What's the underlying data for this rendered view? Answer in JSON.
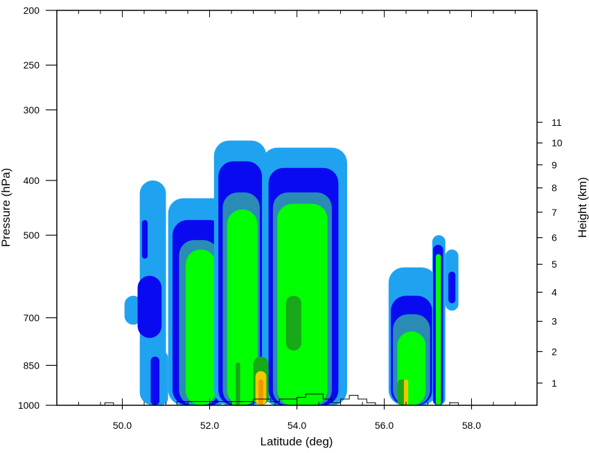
{
  "chart_data": {
    "type": "heatmap",
    "title": "",
    "xlabel": "Latitude (deg)",
    "ylabel_left": "Pressure (hPa)",
    "ylabel_right": "Height (km)",
    "xlim": [
      48.5,
      59.5
    ],
    "ylim_pressure": [
      1000,
      200
    ],
    "y_scale": "log",
    "x_ticks": [
      {
        "value": 50,
        "label": "50.0"
      },
      {
        "value": 52,
        "label": "52.0"
      },
      {
        "value": 54,
        "label": "54.0"
      },
      {
        "value": 56,
        "label": "56.0"
      },
      {
        "value": 58,
        "label": "58.0"
      }
    ],
    "x_minor_step": 0.5,
    "y_ticks_pressure": [
      {
        "value": 1000,
        "label": "1000"
      },
      {
        "value": 850,
        "label": "850"
      },
      {
        "value": 700,
        "label": "700"
      },
      {
        "value": 500,
        "label": "500"
      },
      {
        "value": 400,
        "label": "400"
      },
      {
        "value": 300,
        "label": "300"
      },
      {
        "value": 250,
        "label": "250"
      },
      {
        "value": 200,
        "label": "200"
      }
    ],
    "y_ticks_height": [
      {
        "value": 1,
        "label": "1"
      },
      {
        "value": 2,
        "label": "2"
      },
      {
        "value": 3,
        "label": "3"
      },
      {
        "value": 4,
        "label": "4"
      },
      {
        "value": 5,
        "label": "5"
      },
      {
        "value": 6,
        "label": "6"
      },
      {
        "value": 7,
        "label": "7"
      },
      {
        "value": 8,
        "label": "8"
      },
      {
        "value": 9,
        "label": "9"
      },
      {
        "value": 10,
        "label": "10"
      },
      {
        "value": 11,
        "label": "11"
      }
    ],
    "grid": false,
    "legend": "none",
    "levels": [
      {
        "color": "#1fa3f0"
      },
      {
        "color": "#0a0af0"
      },
      {
        "color": "#2a8cb4"
      },
      {
        "color": "#00ff00"
      },
      {
        "color": "#18a818"
      },
      {
        "color": "#f0c800"
      },
      {
        "color": "#f09600"
      }
    ],
    "cells": [
      {
        "level": 0,
        "x": [
          50.4,
          51.0
        ],
        "p": [
          1000,
          400
        ]
      },
      {
        "level": 1,
        "x": [
          50.45,
          50.58
        ],
        "p": [
          550,
          470
        ]
      },
      {
        "level": 0,
        "x": [
          50.05,
          50.45
        ],
        "p": [
          720,
          640
        ]
      },
      {
        "level": 1,
        "x": [
          50.35,
          50.9
        ],
        "p": [
          760,
          590
        ]
      },
      {
        "level": 0,
        "x": [
          50.7,
          51.05
        ],
        "p": [
          1000,
          800
        ]
      },
      {
        "level": 1,
        "x": [
          50.65,
          50.85
        ],
        "p": [
          1000,
          820
        ]
      },
      {
        "level": 0,
        "x": [
          51.05,
          52.5
        ],
        "p": [
          1000,
          430
        ]
      },
      {
        "level": 1,
        "x": [
          51.15,
          52.35
        ],
        "p": [
          1000,
          470
        ]
      },
      {
        "level": 2,
        "x": [
          51.3,
          52.2
        ],
        "p": [
          1000,
          510
        ]
      },
      {
        "level": 3,
        "x": [
          51.45,
          52.15
        ],
        "p": [
          1000,
          530
        ]
      },
      {
        "level": 0,
        "x": [
          52.1,
          53.3
        ],
        "p": [
          1000,
          340
        ]
      },
      {
        "level": 1,
        "x": [
          52.2,
          53.2
        ],
        "p": [
          1000,
          370
        ]
      },
      {
        "level": 2,
        "x": [
          52.3,
          53.15
        ],
        "p": [
          1000,
          420
        ]
      },
      {
        "level": 3,
        "x": [
          52.4,
          53.1
        ],
        "p": [
          1000,
          450
        ]
      },
      {
        "level": 0,
        "x": [
          53.2,
          55.15
        ],
        "p": [
          1000,
          350
        ]
      },
      {
        "level": 1,
        "x": [
          53.35,
          54.95
        ],
        "p": [
          1000,
          380
        ]
      },
      {
        "level": 2,
        "x": [
          53.45,
          54.8
        ],
        "p": [
          1000,
          420
        ]
      },
      {
        "level": 3,
        "x": [
          53.55,
          54.7
        ],
        "p": [
          1000,
          440
        ]
      },
      {
        "level": 4,
        "x": [
          53.75,
          54.1
        ],
        "p": [
          800,
          640
        ]
      },
      {
        "level": 3,
        "x": [
          52.5,
          52.6
        ],
        "p": [
          1000,
          720
        ]
      },
      {
        "level": 4,
        "x": [
          52.6,
          52.7
        ],
        "p": [
          1000,
          840
        ]
      },
      {
        "level": 4,
        "x": [
          53.0,
          53.35
        ],
        "p": [
          1000,
          820
        ]
      },
      {
        "level": 5,
        "x": [
          53.05,
          53.3
        ],
        "p": [
          1000,
          870
        ]
      },
      {
        "level": 6,
        "x": [
          53.12,
          53.23
        ],
        "p": [
          1000,
          900
        ]
      },
      {
        "level": 0,
        "x": [
          56.1,
          57.2
        ],
        "p": [
          1000,
          570
        ]
      },
      {
        "level": 1,
        "x": [
          56.15,
          57.1
        ],
        "p": [
          1000,
          640
        ]
      },
      {
        "level": 2,
        "x": [
          56.2,
          57.05
        ],
        "p": [
          1000,
          690
        ]
      },
      {
        "level": 3,
        "x": [
          56.3,
          56.95
        ],
        "p": [
          1000,
          740
        ]
      },
      {
        "level": 4,
        "x": [
          56.3,
          56.5
        ],
        "p": [
          1000,
          900
        ]
      },
      {
        "level": 5,
        "x": [
          56.45,
          56.55
        ],
        "p": [
          1000,
          900
        ]
      },
      {
        "level": 0,
        "x": [
          57.1,
          57.4
        ],
        "p": [
          1000,
          500
        ]
      },
      {
        "level": 1,
        "x": [
          57.12,
          57.35
        ],
        "p": [
          1000,
          520
        ]
      },
      {
        "level": 3,
        "x": [
          57.18,
          57.3
        ],
        "p": [
          1000,
          540
        ]
      },
      {
        "level": 0,
        "x": [
          57.4,
          57.7
        ],
        "p": [
          680,
          530
        ]
      },
      {
        "level": 1,
        "x": [
          57.47,
          57.63
        ],
        "p": [
          660,
          580
        ]
      }
    ],
    "terrain_profile": [
      [
        49.5,
        1000
      ],
      [
        49.6,
        1000
      ],
      [
        49.6,
        990
      ],
      [
        49.8,
        990
      ],
      [
        49.8,
        1000
      ],
      [
        50.3,
        1000
      ],
      [
        51.25,
        1000
      ],
      [
        51.25,
        985
      ],
      [
        53.0,
        985
      ],
      [
        53.0,
        975
      ],
      [
        53.4,
        975
      ],
      [
        53.4,
        985
      ],
      [
        53.6,
        985
      ],
      [
        53.6,
        975
      ],
      [
        54.0,
        975
      ],
      [
        54.0,
        968
      ],
      [
        54.2,
        968
      ],
      [
        54.2,
        955
      ],
      [
        54.6,
        955
      ],
      [
        54.6,
        975
      ],
      [
        54.8,
        975
      ],
      [
        54.8,
        990
      ],
      [
        55.0,
        990
      ],
      [
        55.0,
        975
      ],
      [
        55.2,
        975
      ],
      [
        55.2,
        960
      ],
      [
        55.4,
        960
      ],
      [
        55.4,
        975
      ],
      [
        55.6,
        975
      ],
      [
        55.6,
        990
      ],
      [
        55.8,
        990
      ],
      [
        55.8,
        1000
      ],
      [
        56.0,
        1000
      ],
      [
        56.0,
        1000
      ],
      [
        57.5,
        1000
      ],
      [
        57.5,
        990
      ],
      [
        57.7,
        990
      ],
      [
        57.7,
        1000
      ],
      [
        59.0,
        1000
      ]
    ]
  }
}
